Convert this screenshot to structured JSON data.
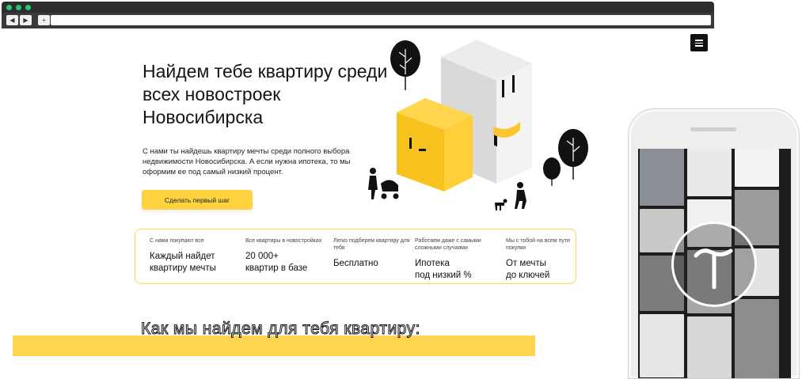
{
  "hero": {
    "title": "Найдем тебе квартиру среди всех новостроек Новосибирска",
    "description": "С нами ты найдешь квартиру мечты среди полного выбора недвижимости Новосибирска. А если нужна ипотека, то мы оформим ее под самый низкий процент.",
    "cta_label": "Сделать первый шаг"
  },
  "stats": [
    {
      "caption": "С нами покупают все",
      "value": "Каждый найдет\nквартиру мечты"
    },
    {
      "caption": "Все квартиры в новостройках",
      "value": "20 000+\nквартир в базе"
    },
    {
      "caption": "Легко подберем квартиру для тебя",
      "value": "Бесплатно"
    },
    {
      "caption": "Работаем даже с самыми сложными случаями",
      "value": "Ипотека\nпод низкий %"
    },
    {
      "caption": "Мы с тобой на всем пути покупки",
      "value": "От мечты\nдо ключей"
    }
  ],
  "section_title": "Как мы найдем для тебя квартиру:",
  "browser": {
    "back_glyph": "◀",
    "forward_glyph": "▶",
    "new_tab_glyph": "+"
  },
  "colors": {
    "accent_yellow": "#ffd23f",
    "chrome_dark": "#2d2d2d",
    "traffic_dot": "#27c96b"
  },
  "icons": [
    "menu-icon",
    "tilda-logo-icon"
  ]
}
